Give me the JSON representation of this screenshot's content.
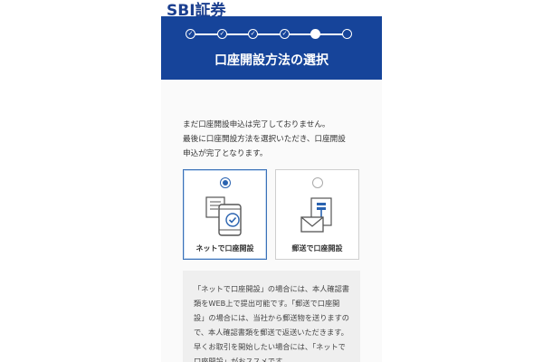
{
  "brand": {
    "logo_text": "SBI証券",
    "color": "#1b3f8f"
  },
  "header": {
    "title": "口座開設方法の選択",
    "background": "#16449a",
    "steps": {
      "total": 6,
      "completed": 4,
      "current": 5,
      "completed_mark": "✓"
    }
  },
  "notice": {
    "line1": "まだ口座開設申込は完了しておりません。",
    "line2": "最後に口座開設方法を選択いただき、口座開設",
    "line3": "申込が完了となります。"
  },
  "options": [
    {
      "label": "ネットで口座開設",
      "selected": true,
      "icon": "smartphone-document-icon"
    },
    {
      "label": "郵送で口座開設",
      "selected": false,
      "icon": "mail-document-icon"
    }
  ],
  "info": {
    "line1": "「ネットで口座開設」の場合には、本人確認書",
    "line2": "類をWEB上で提出可能です。「郵送で口座開",
    "line3": "設」の場合には、当社から郵送物を送りますの",
    "line4": "で、本人確認書類を郵送で返送いただきます。",
    "line5": "早くお取引を開始したい場合には、「ネットで",
    "line6": "口座開設」がおススメです。"
  }
}
